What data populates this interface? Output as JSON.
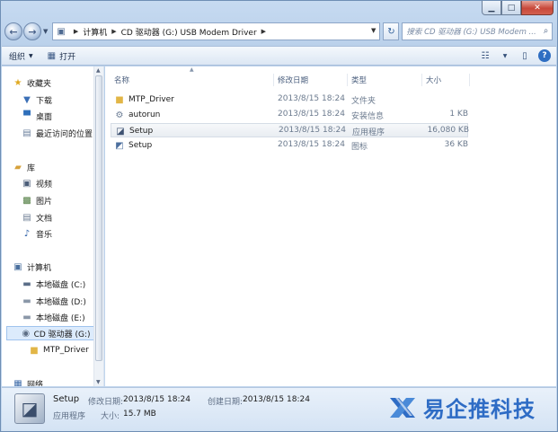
{
  "window": {
    "caption": {
      "minimize": "▁",
      "maximize": "□",
      "close": "✕"
    }
  },
  "address_bar": {
    "crumbs": [
      "计算机",
      "CD 驱动器 (G:) USB Modem Driver"
    ],
    "search_placeholder": "搜索 CD 驱动器 (G:) USB Modem ..."
  },
  "toolbar": {
    "organize": "组织",
    "open": "打开"
  },
  "nav": {
    "favorites": "收藏夹",
    "downloads": "下载",
    "desktop": "桌面",
    "recent": "最近访问的位置",
    "libraries": "库",
    "videos": "视频",
    "pictures": "图片",
    "documents": "文档",
    "music": "音乐",
    "computer": "计算机",
    "disk_c": "本地磁盘 (C:)",
    "disk_d": "本地磁盘 (D:)",
    "disk_e": "本地磁盘 (E:)",
    "cd_drive": "CD 驱动器 (G:) U",
    "mtp_driver": "MTP_Driver",
    "network": "网络"
  },
  "columns": {
    "name": "名称",
    "date": "修改日期",
    "type": "类型",
    "size": "大小"
  },
  "files": [
    {
      "name": "MTP_Driver",
      "date": "2013/8/15 18:24",
      "type": "文件夹",
      "size": "",
      "icon": "folder-icon"
    },
    {
      "name": "autorun",
      "date": "2013/8/15 18:24",
      "type": "安装信息",
      "size": "1 KB",
      "icon": "settings-file-icon"
    },
    {
      "name": "Setup",
      "date": "2013/8/15 18:24",
      "type": "应用程序",
      "size": "16,080 KB",
      "icon": "setup-app-icon"
    },
    {
      "name": "Setup",
      "date": "2013/8/15 18:24",
      "type": "图标",
      "size": "36 KB",
      "icon": "icon-file-icon"
    }
  ],
  "details": {
    "name": "Setup",
    "modified_label": "修改日期:",
    "modified_value": "2013/8/15 18:24",
    "created_label": "创建日期:",
    "created_value": "2013/8/15 18:24",
    "type": "应用程序",
    "size_label": "大小:",
    "size_value": "15.7 MB"
  },
  "watermark": {
    "text": "易企推科技"
  },
  "colors": {
    "accent": "#2e6cc5",
    "selection": "#dcebfc",
    "window_frame": "#b8cfe9"
  }
}
